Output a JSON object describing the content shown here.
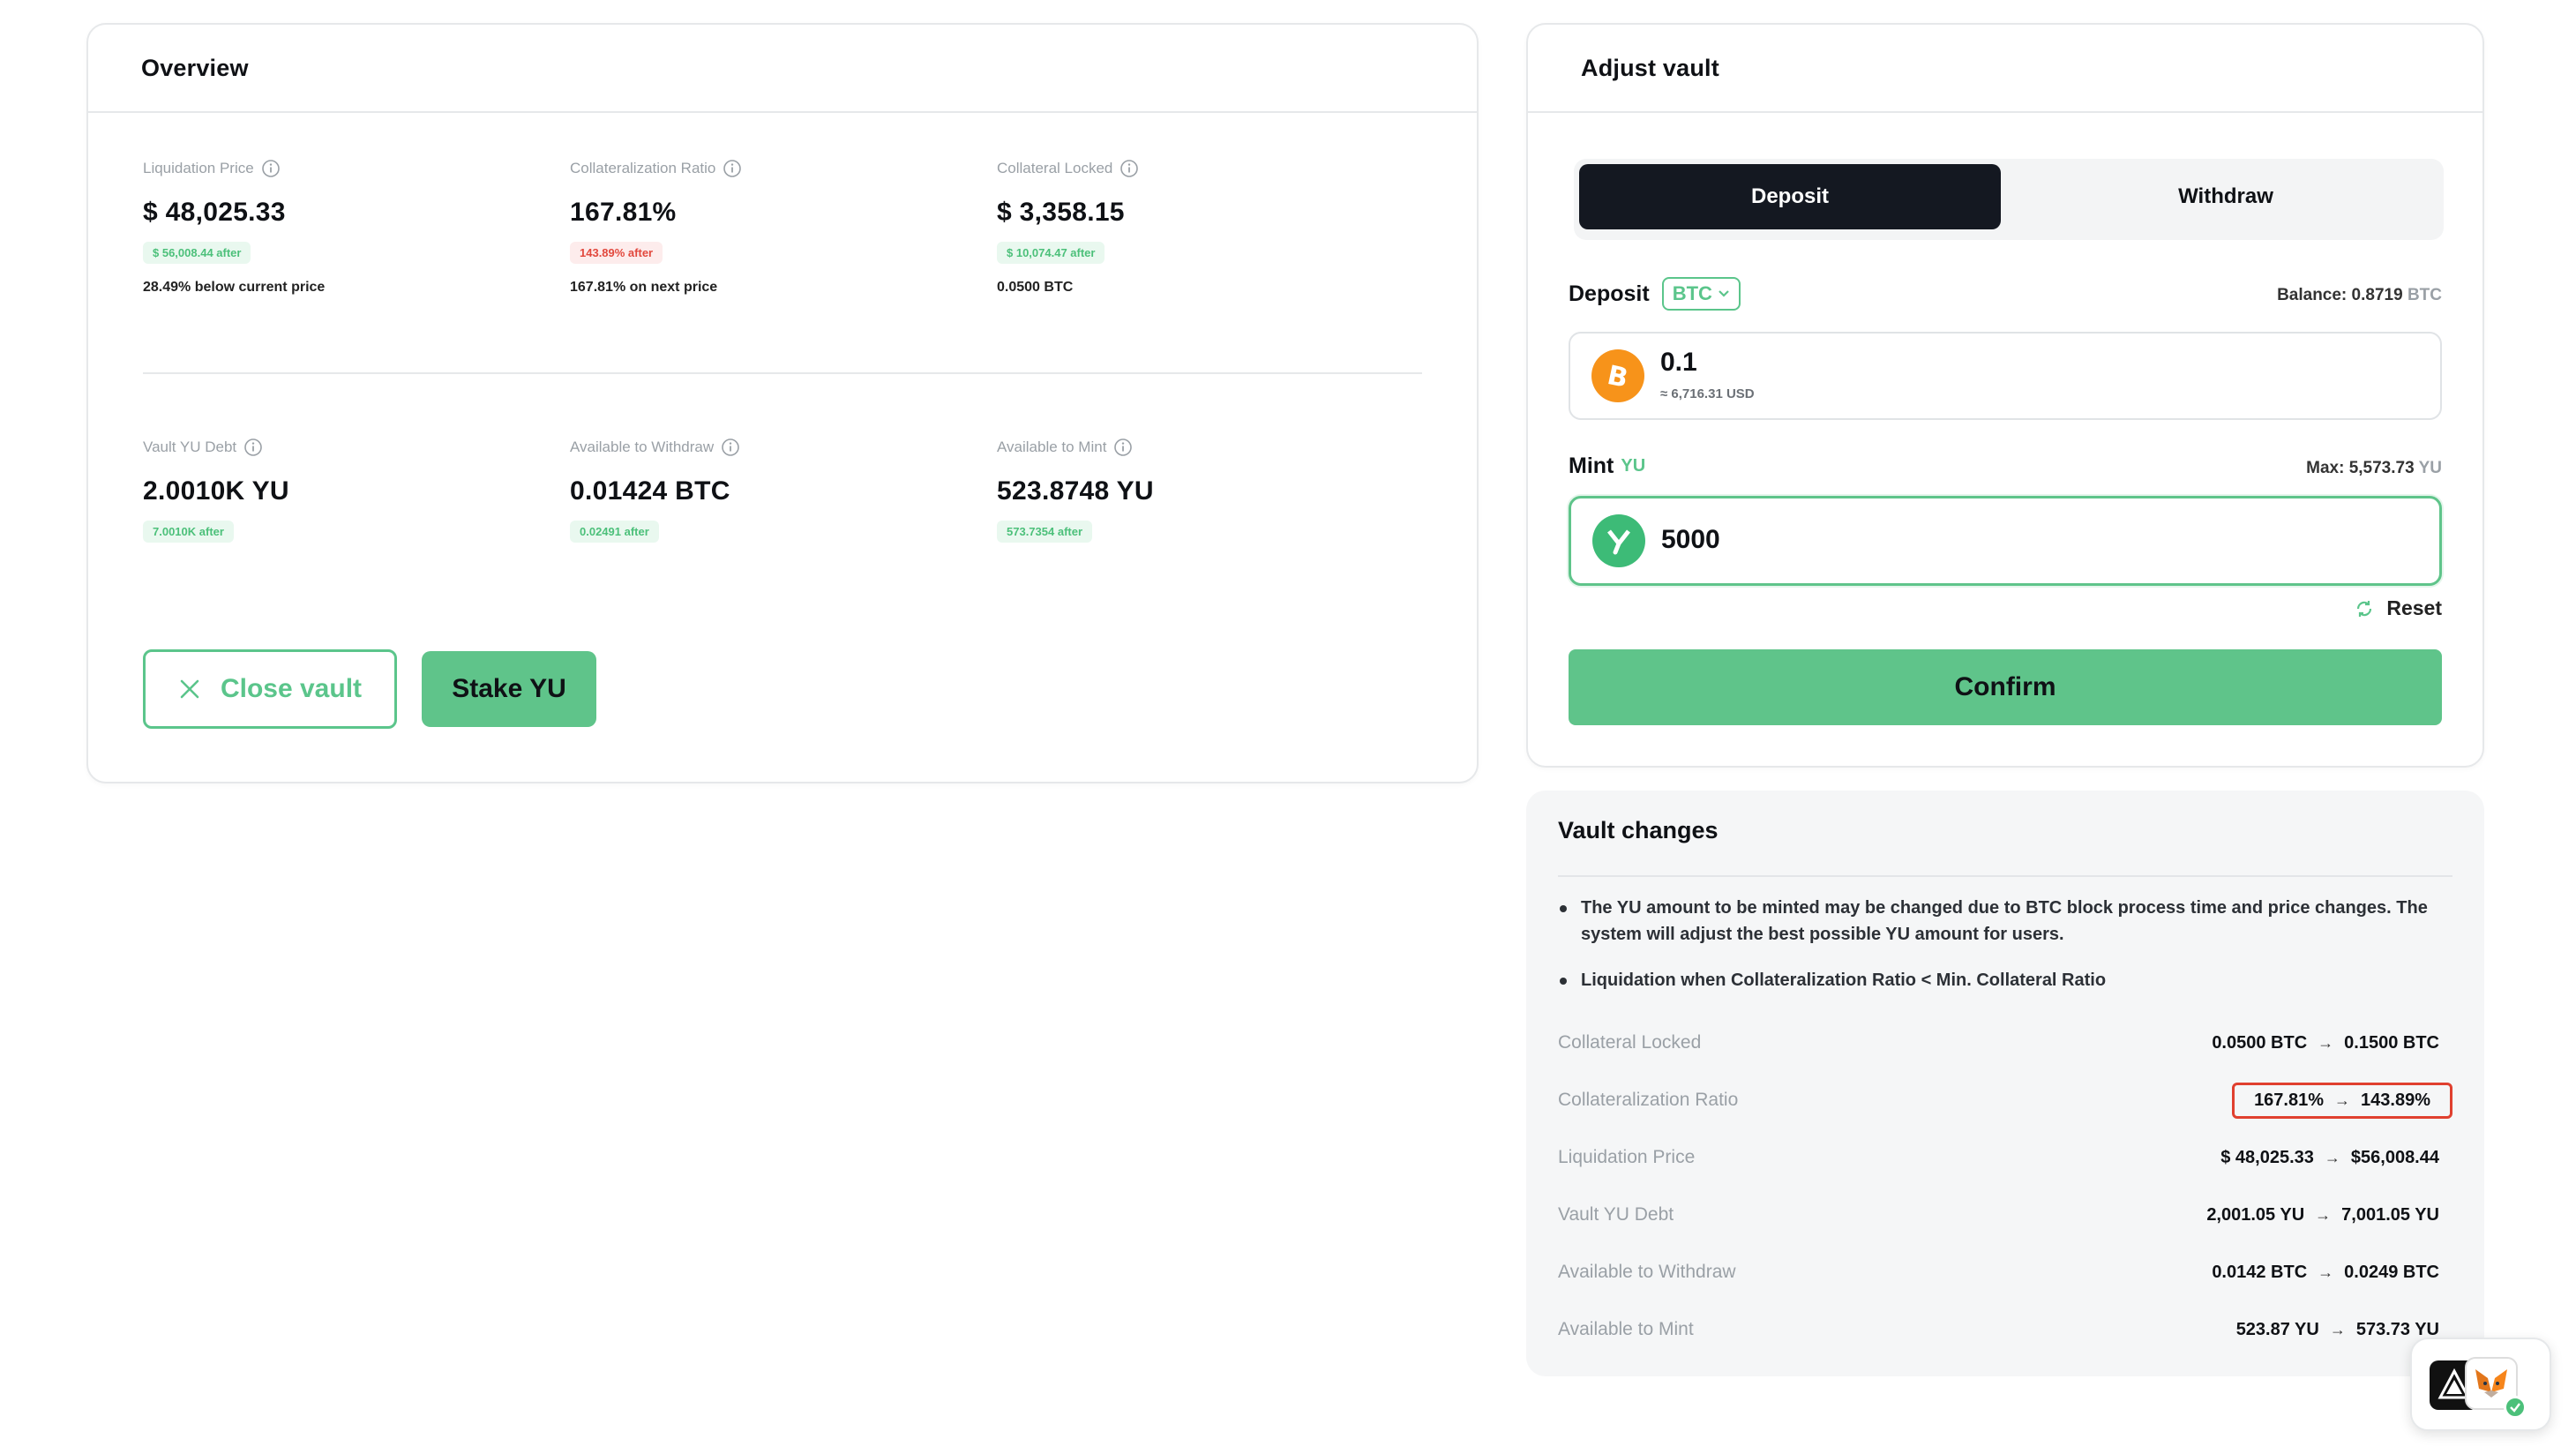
{
  "overview": {
    "title": "Overview",
    "stats": [
      {
        "label": "Liquidation Price",
        "value": "$ 48,025.33",
        "pill": "$ 56,008.44 after",
        "pill_tone": "green",
        "sub": "28.49% below current price"
      },
      {
        "label": "Collateralization Ratio",
        "value": "167.81%",
        "pill": "143.89% after",
        "pill_tone": "red",
        "sub": "167.81% on next price"
      },
      {
        "label": "Collateral Locked",
        "value": "$ 3,358.15",
        "pill": "$ 10,074.47 after",
        "pill_tone": "green",
        "sub": "0.0500 BTC"
      },
      {
        "label": "Vault YU Debt",
        "value": "2.0010K YU",
        "pill": "7.0010K after",
        "pill_tone": "green",
        "sub": ""
      },
      {
        "label": "Available to Withdraw",
        "value": "0.01424 BTC",
        "pill": "0.02491 after",
        "pill_tone": "green",
        "sub": ""
      },
      {
        "label": "Available to Mint",
        "value": "523.8748 YU",
        "pill": "573.7354 after",
        "pill_tone": "green",
        "sub": ""
      }
    ],
    "close_label": "Close vault",
    "stake_label": "Stake YU"
  },
  "adjust": {
    "title": "Adjust vault",
    "tabs": {
      "deposit": "Deposit",
      "withdraw": "Withdraw",
      "active": "Deposit"
    },
    "deposit": {
      "label": "Deposit",
      "token": "BTC",
      "balance_prefix": "Balance: 0.8719",
      "balance_unit": "BTC",
      "amount": "0.1",
      "amount_usd": "≈ 6,716.31 USD",
      "icon": "bitcoin-icon"
    },
    "mint": {
      "label": "Mint",
      "token": "YU",
      "max_prefix": "Max: 5,573.73",
      "max_unit": "YU",
      "amount": "5000",
      "icon": "yu-token-icon"
    },
    "reset_label": "Reset",
    "confirm_label": "Confirm"
  },
  "changes": {
    "title": "Vault changes",
    "notes": [
      "The YU amount to be minted may be changed due to BTC block process time and price changes. The system will adjust the best possible YU amount for users.",
      "Liquidation when Collateralization Ratio < Min. Collateral Ratio"
    ],
    "rows": [
      {
        "label": "Collateral Locked",
        "from": "0.0500 BTC",
        "to": "0.1500 BTC",
        "highlight": false
      },
      {
        "label": "Collateralization Ratio",
        "from": "167.81%",
        "to": "143.89%",
        "highlight": true
      },
      {
        "label": "Liquidation Price",
        "from": "$ 48,025.33",
        "to": "$56,008.44",
        "highlight": false
      },
      {
        "label": "Vault YU Debt",
        "from": "2,001.05 YU",
        "to": "7,001.05 YU",
        "highlight": false
      },
      {
        "label": "Available to Withdraw",
        "from": "0.0142 BTC",
        "to": "0.0249 BTC",
        "highlight": false
      },
      {
        "label": "Available to Mint",
        "from": "523.87 YU",
        "to": "573.73 YU",
        "highlight": false
      }
    ]
  },
  "colors": {
    "accent": "#5fc48a",
    "dark": "#141821",
    "danger": "#e2483d",
    "btc": "#f7931a"
  }
}
